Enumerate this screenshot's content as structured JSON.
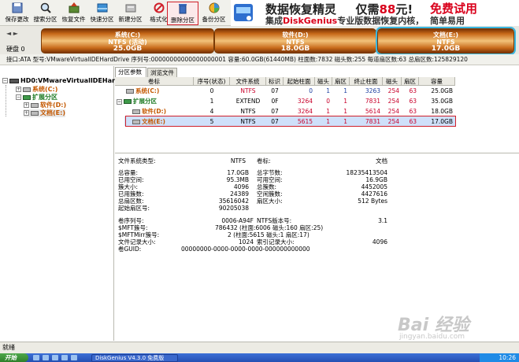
{
  "toolbar": {
    "buttons": [
      {
        "label": "保存更改",
        "icon": "save-icon"
      },
      {
        "label": "搜索分区",
        "icon": "search-icon"
      },
      {
        "label": "恢复文件",
        "icon": "recover-file-icon"
      },
      {
        "label": "快速分区",
        "icon": "quick-partition-icon"
      },
      {
        "label": "新建分区",
        "icon": "new-partition-icon"
      },
      {
        "label": "格式化",
        "icon": "format-icon"
      },
      {
        "label": "删除分区",
        "icon": "delete-partition-icon"
      },
      {
        "label": "备份分区",
        "icon": "backup-partition-icon"
      }
    ]
  },
  "ad": {
    "title": "数据恢复精灵",
    "price_prefix": "仅需",
    "price": "88",
    "price_suffix": "元!",
    "trial": "免费试用",
    "line2_prefix": "集成",
    "line2_brand": "DiskGenius",
    "line2_suffix": "专业版数据恢复内核，",
    "easy": "简单易用"
  },
  "disk_nav": "◄ ►",
  "disk_name": "硬盘 0",
  "partitions": [
    {
      "name": "系统(C:)",
      "fs": "NTFS (活动)",
      "size": "25.0GB"
    },
    {
      "name": "软件(D:)",
      "fs": "NTFS",
      "size": "18.0GB"
    },
    {
      "name": "文档(E:)",
      "fs": "NTFS",
      "size": "17.0GB"
    }
  ],
  "disk_info": "接口:ATA  型号:VMwareVirtualIDEHardDrive  序列号:00000000000000000001  容量:60.0GB(61440MB)  柱面数:7832  磁头数:255  每道扇区数:63  总扇区数:125829120",
  "tree": {
    "root": "HD0:VMwareVirtualIDEHardD",
    "items": [
      {
        "label": "系统(C:)"
      },
      {
        "label": "扩展分区"
      },
      {
        "label": "软件(D:)"
      },
      {
        "label": "文档(E:)"
      }
    ]
  },
  "tabs": [
    "分区参数",
    "浏览文件"
  ],
  "table": {
    "headers": [
      "卷标",
      "序号(状态)",
      "文件系统",
      "标识",
      "起始柱面",
      "磁头",
      "扇区",
      "终止柱面",
      "磁头",
      "扇区",
      "容量"
    ],
    "rows": [
      {
        "name": "系统(C:)",
        "idx": "0",
        "fs": "NTFS",
        "id": "07",
        "sc": "0",
        "sh": "1",
        "ss": "1",
        "ec": "3263",
        "eh": "254",
        "es": "63",
        "cap": "25.0GB"
      },
      {
        "name": "扩展分区",
        "idx": "1",
        "fs": "EXTEND",
        "id": "0F",
        "sc": "3264",
        "sh": "0",
        "ss": "1",
        "ec": "7831",
        "eh": "254",
        "es": "63",
        "cap": "35.0GB"
      },
      {
        "name": "软件(D:)",
        "idx": "4",
        "fs": "NTFS",
        "id": "07",
        "sc": "3264",
        "sh": "1",
        "ss": "1",
        "ec": "5614",
        "eh": "254",
        "es": "63",
        "cap": "18.0GB"
      },
      {
        "name": "文档(E:)",
        "idx": "5",
        "fs": "NTFS",
        "id": "07",
        "sc": "5615",
        "sh": "1",
        "ss": "1",
        "ec": "7831",
        "eh": "254",
        "es": "63",
        "cap": "17.0GB"
      }
    ]
  },
  "detail": {
    "fs_type_label": "文件系统类型:",
    "fs_type_value": "NTFS",
    "vol_label_label": "卷标:",
    "vol_label_value": "文档",
    "left": [
      {
        "k": "总容量:",
        "v": "17.0GB"
      },
      {
        "k": "已用空间:",
        "v": "95.3MB"
      },
      {
        "k": "簇大小:",
        "v": "4096"
      },
      {
        "k": "已用簇数:",
        "v": "24389"
      },
      {
        "k": "总扇区数:",
        "v": "35616042"
      },
      {
        "k": "起始扇区号:",
        "v": "90205038"
      }
    ],
    "right": [
      {
        "k": "总字节数:",
        "v": "18235413504"
      },
      {
        "k": "可用空间:",
        "v": "16.9GB"
      },
      {
        "k": "总簇数:",
        "v": "4452005"
      },
      {
        "k": "空闲簇数:",
        "v": "4427616"
      },
      {
        "k": "扇区大小:",
        "v": "512 Bytes"
      }
    ],
    "serial_label": "卷序列号:",
    "serial_value": "0006-A94F",
    "ntfs_ver_label": "NTFS版本号:",
    "ntfs_ver_value": "3.1",
    "mft_label": "$MFT簇号:",
    "mft_value": "786432 (柱面:6006 磁头:160 扇区:25)",
    "mftmirr_label": "$MFTMirr簇号:",
    "mftmirr_value": "2 (柱面:5615 磁头:1 扇区:17)",
    "rec_label": "文件记录大小:",
    "rec_value": "1024",
    "idx_label": "索引记录大小:",
    "idx_value": "4096",
    "guid_label": "卷GUID:",
    "guid_value": "00000000-0000-0000-0000-000000000000"
  },
  "status": "就绪",
  "taskbar": {
    "start": "开始",
    "app": "DiskGenius V4.3.0 免费版",
    "time": "10:26"
  },
  "watermark": {
    "brand": "Bai 经验",
    "url": "jingyan.baidu.com"
  }
}
